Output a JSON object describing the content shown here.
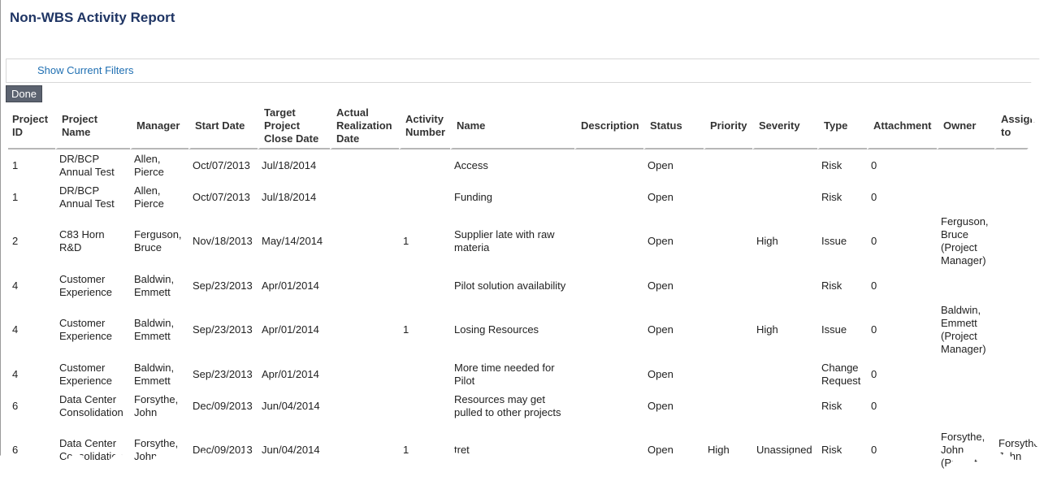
{
  "report": {
    "title": "Non-WBS Activity Report",
    "show_filters_label": "Show Current Filters",
    "done_label": "Done"
  },
  "table": {
    "columns": [
      "Project ID",
      "Project Name",
      "Manager",
      "Start Date",
      "Target Project Close Date",
      "Actual Realization Date",
      "Activity Number",
      "Name",
      "Description",
      "Status",
      "Priority",
      "Severity",
      "Type",
      "Attachment",
      "Owner",
      "Assign to"
    ],
    "rows": [
      [
        "1",
        "DR/BCP Annual Test",
        "Allen, Pierce",
        "Oct/07/2013",
        "Jul/18/2014",
        "",
        "",
        "Access",
        "",
        "Open",
        "",
        "",
        "Risk",
        "0",
        "",
        ""
      ],
      [
        "1",
        "DR/BCP Annual Test",
        "Allen, Pierce",
        "Oct/07/2013",
        "Jul/18/2014",
        "",
        "",
        "Funding",
        "",
        "Open",
        "",
        "",
        "Risk",
        "0",
        "",
        ""
      ],
      [
        "2",
        "C83 Horn R&D",
        "Ferguson, Bruce",
        "Nov/18/2013",
        "May/14/2014",
        "",
        "1",
        "Supplier late with raw materia",
        "",
        "Open",
        "",
        "High",
        "Issue",
        "0",
        "Ferguson, Bruce (Project Manager)",
        ""
      ],
      [
        "4",
        "Customer Experience",
        "Baldwin, Emmett",
        "Sep/23/2013",
        "Apr/01/2014",
        "",
        "",
        "Pilot solution availability",
        "",
        "Open",
        "",
        "",
        "Risk",
        "0",
        "",
        ""
      ],
      [
        "4",
        "Customer Experience",
        "Baldwin, Emmett",
        "Sep/23/2013",
        "Apr/01/2014",
        "",
        "1",
        "Losing Resources",
        "",
        "Open",
        "",
        "High",
        "Issue",
        "0",
        "Baldwin, Emmett (Project Manager)",
        ""
      ],
      [
        "4",
        "Customer Experience",
        "Baldwin, Emmett",
        "Sep/23/2013",
        "Apr/01/2014",
        "",
        "",
        "More time needed for Pilot",
        "",
        "Open",
        "",
        "",
        "Change Request",
        "0",
        "",
        ""
      ],
      [
        "6",
        "Data Center Consolidation",
        "Forsythe, John",
        "Dec/09/2013",
        "Jun/04/2014",
        "",
        "",
        "Resources may get pulled to other projects",
        "",
        "Open",
        "",
        "",
        "Risk",
        "0",
        "",
        ""
      ],
      [
        "6",
        "Data Center Consolidation",
        "Forsythe, John",
        "Dec/09/2013",
        "Jun/04/2014",
        "",
        "1",
        "tret",
        "",
        "Open",
        "High",
        "Unassigned",
        "Risk",
        "0",
        "Forsythe, John (Project",
        "Forsythe, John"
      ]
    ]
  },
  "colors": {
    "title": "#1f3564",
    "link": "#1f6fb2",
    "button_bg": "#5c6370",
    "header_rule": "#b7b7b7"
  }
}
